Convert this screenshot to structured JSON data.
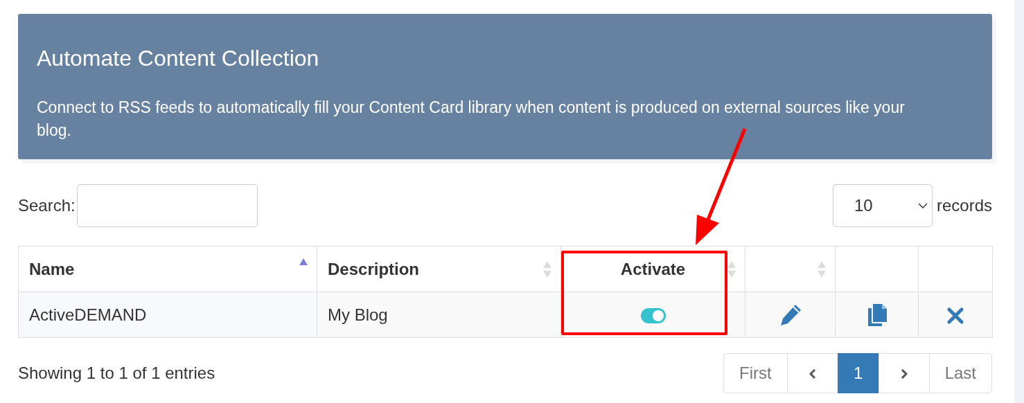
{
  "banner": {
    "title": "Automate Content Collection",
    "text": "Connect to RSS feeds to automatically fill your Content Card library when content is produced on external sources like your blog."
  },
  "search": {
    "label": "Search:"
  },
  "page_length": {
    "value": "10",
    "label": "records"
  },
  "table": {
    "columns": [
      {
        "label": "Name",
        "sortable": true,
        "sorted": true
      },
      {
        "label": "Description",
        "sortable": true,
        "sorted": false
      },
      {
        "label": "Activate",
        "sortable": true,
        "sorted": false
      },
      {
        "sortable": true,
        "sorted": false
      },
      {},
      {}
    ],
    "rows": [
      {
        "name": "ActiveDEMAND",
        "description": "My Blog",
        "active": true,
        "actions": [
          {
            "kind": "edit"
          },
          {
            "kind": "copy"
          },
          {
            "kind": "delete"
          }
        ]
      }
    ]
  },
  "info": "Showing 1 to 1 of 1 entries",
  "pagination": [
    {
      "kind": "text",
      "label": "First",
      "selected": false
    },
    {
      "kind": "prev",
      "selected": false
    },
    {
      "kind": "text",
      "label": "1",
      "selected": true
    },
    {
      "kind": "next",
      "selected": false
    },
    {
      "kind": "text",
      "label": "Last",
      "selected": false
    }
  ]
}
